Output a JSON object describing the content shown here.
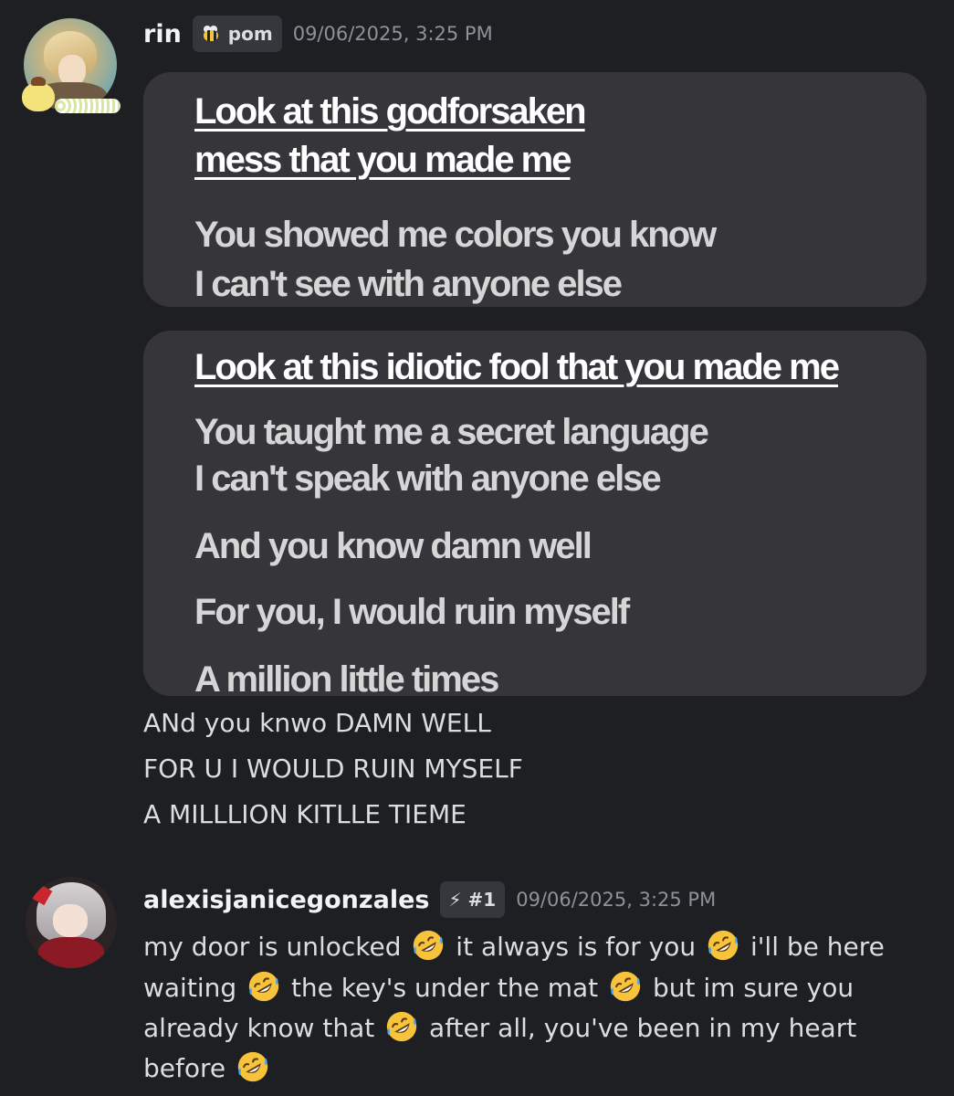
{
  "messages": [
    {
      "username": "rin",
      "tag": {
        "icon": "bee-icon",
        "label": "pom"
      },
      "timestamp": "09/06/2025, 3:25 PM",
      "attachments": [
        {
          "type": "lyric-image",
          "lines": [
            {
              "text": "Look at this godforsaken",
              "style": "title"
            },
            {
              "text": "mess that you made me",
              "style": "title"
            },
            {
              "text": "You showed me colors you know",
              "style": "body"
            },
            {
              "text": "I can't see with anyone else",
              "style": "body"
            }
          ]
        },
        {
          "type": "lyric-image",
          "lines": [
            {
              "text": "Look at this idiotic fool that you made me",
              "style": "title"
            },
            {
              "text": "You taught me a secret language",
              "style": "body"
            },
            {
              "text": "I can't speak with anyone else",
              "style": "body"
            },
            {
              "text": "And you know damn well",
              "style": "body"
            },
            {
              "text": "For you, I would ruin myself",
              "style": "body"
            },
            {
              "text": "A million little times",
              "style": "body"
            }
          ]
        }
      ],
      "text_lines": [
        "ANd you knwo DAMN WELL",
        "FOR U I WOULD RUIN MYSELF",
        "A MILLLION KITLLE TIEME"
      ]
    },
    {
      "username": "alexisjanicegonzales",
      "tag": {
        "icon": "lightning-icon",
        "icon_glyph": "⚡",
        "label": "#1"
      },
      "timestamp": "09/06/2025, 3:25 PM",
      "body_lines": [
        [
          "my door is unlocked",
          "it always is for you",
          "i'll be here"
        ],
        [
          "waiting",
          "the key's under the mat",
          "but im sure you"
        ],
        [
          "already know that",
          "after all, you've been in my heart"
        ],
        [
          "before"
        ]
      ],
      "emoji": "rolling-on-floor-laughing-icon"
    }
  ]
}
